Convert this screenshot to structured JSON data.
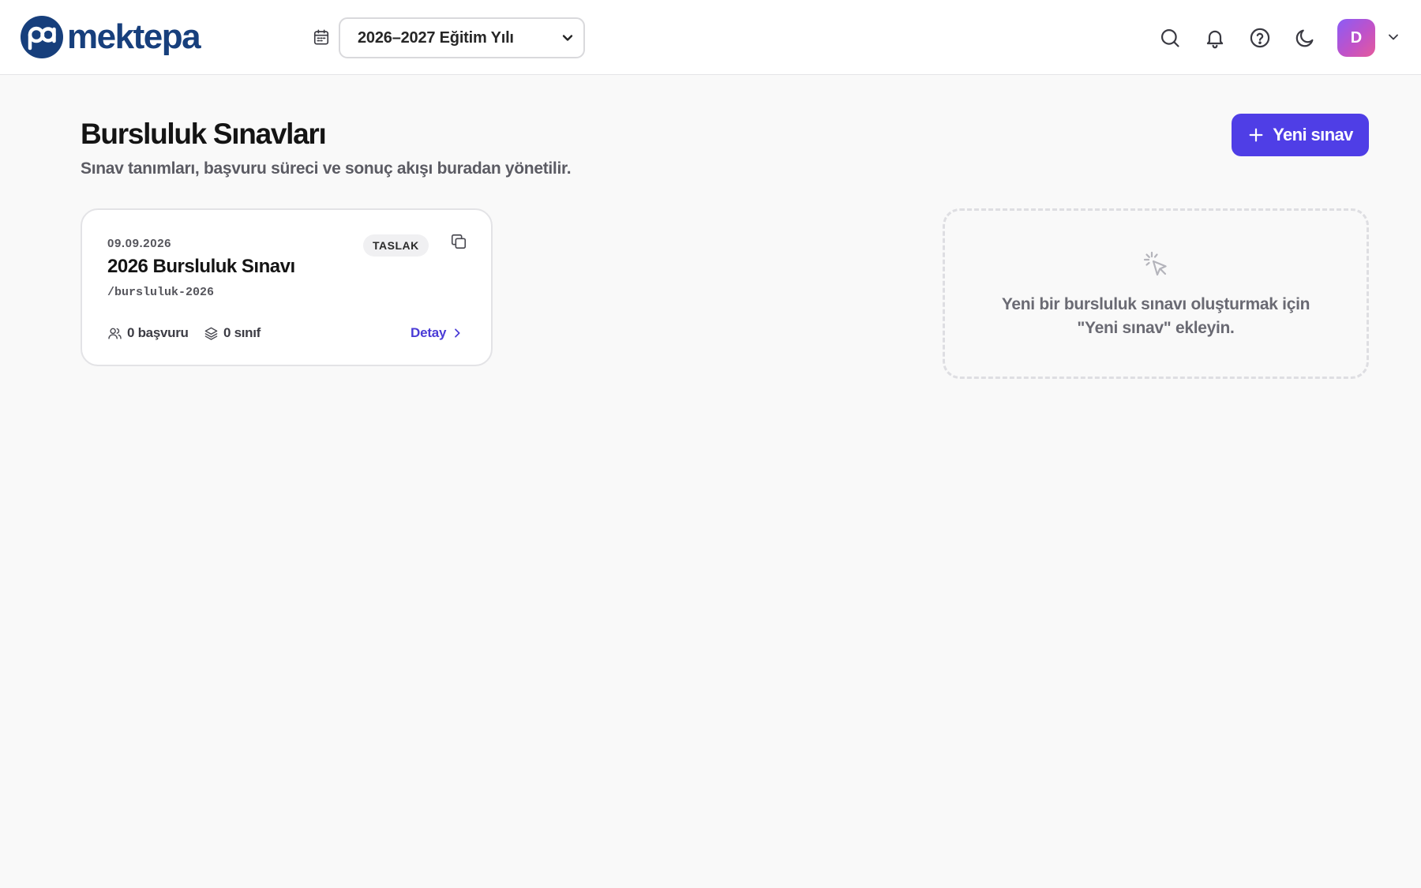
{
  "topbar": {
    "brand": "mektepa",
    "academic_year": "2026–2027 Eğitim Yılı",
    "user_initial": "D"
  },
  "page": {
    "title": "Bursluluk Sınavları",
    "subtitle": "Sınav tanımları, başvuru süreci ve sonuç akışı buradan yönetilir.",
    "new_button_label": "Yeni sınav"
  },
  "exams": [
    {
      "date": "09.09.2026",
      "title": "2026 Bursluluk Sınavı",
      "slug": "/bursluluk-2026",
      "status": "TASLAK",
      "applications": "0 başvuru",
      "classes": "0 sınıf",
      "detail_label": "Detay"
    }
  ],
  "empty_state": {
    "line1": "Yeni bir bursluluk sınavı oluşturmak için",
    "line2": "\"Yeni sınav\" ekleyin."
  },
  "colors": {
    "accent": "#4f3ee6",
    "brand": "#173f7c",
    "background": "#f9f9f9"
  },
  "icons": [
    "calendar-icon",
    "chevron-down-icon",
    "search-icon",
    "bell-icon",
    "help-icon",
    "moon-icon",
    "plus-icon",
    "copy-icon",
    "users-icon",
    "layers-icon",
    "chevron-right-icon",
    "cursor-click-icon"
  ]
}
